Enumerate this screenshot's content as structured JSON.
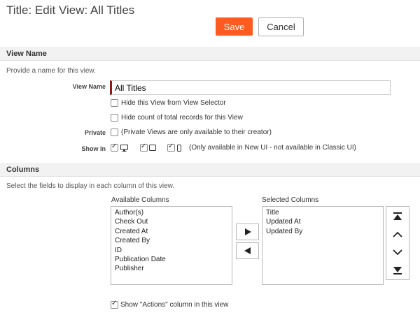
{
  "page": {
    "title": "Title: Edit View: All Titles"
  },
  "actions": {
    "save_label": "Save",
    "cancel_label": "Cancel"
  },
  "view_name_section": {
    "heading": "View Name",
    "description": "Provide a name for this view.",
    "name_label": "View Name",
    "name_value": "All Titles",
    "hide_from_selector_label": "Hide this View from View Selector",
    "hide_count_label": "Hide count of total records for this View",
    "private_label": "Private",
    "private_note": "(Private Views are only available to their creator)",
    "show_in_label": "Show In",
    "show_in_note": "(Only available in New UI - not available in Classic UI)",
    "show_in_options": [
      {
        "icon": "desktop-icon",
        "checked": true
      },
      {
        "icon": "tablet-icon",
        "checked": true
      },
      {
        "icon": "phone-icon",
        "checked": true
      }
    ],
    "hide_from_selector_checked": false,
    "hide_count_checked": false,
    "private_checked": false
  },
  "columns_section": {
    "heading": "Columns",
    "description": "Select the fields to display in each column of this view.",
    "available_title": "Available Columns",
    "available": [
      "Author(s)",
      "Check Out",
      "Created At",
      "Created By",
      "ID",
      "Publication Date",
      "Publisher"
    ],
    "selected_title": "Selected Columns",
    "selected": [
      "Title",
      "Updated At",
      "Updated By"
    ],
    "actions_column_label": "Show \"Actions\" column in this view",
    "actions_column_checked": true
  },
  "colors": {
    "save_button": "#ff5a1f",
    "input_accent": "#8b1a1a",
    "section_bg": "#f2f2f2"
  }
}
